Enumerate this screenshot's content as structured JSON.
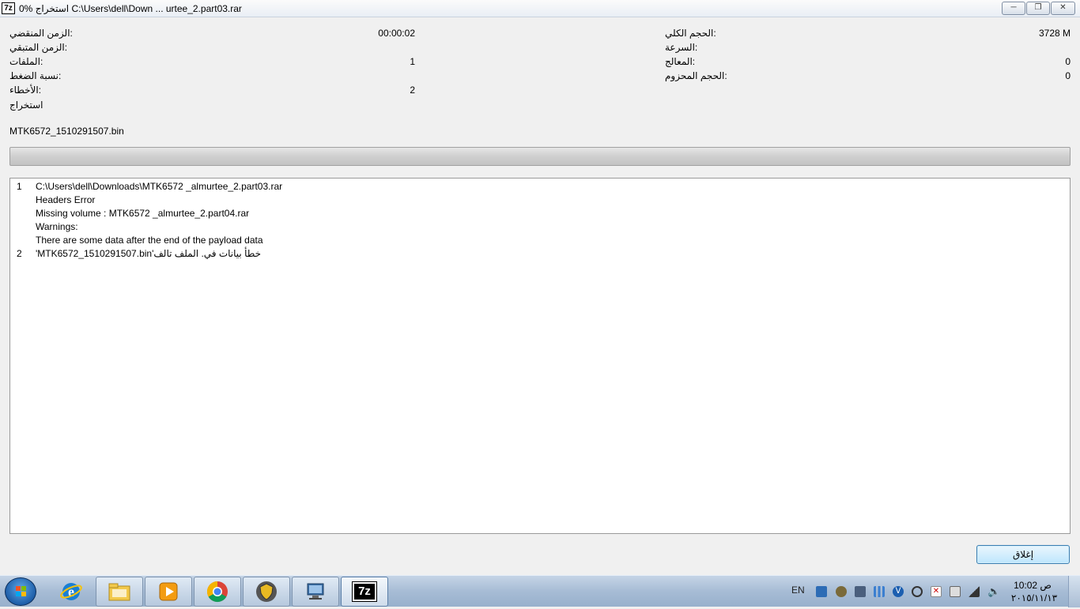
{
  "window": {
    "title": "0% استخراج C:\\Users\\dell\\Down ... urtee_2.part03.rar",
    "app_icon": "7z",
    "controls": {
      "minimize": "minimize-icon",
      "maximize": "restore-icon",
      "close": "close-icon"
    }
  },
  "stats_left": [
    {
      "label": "الزمن المنقضي:",
      "value": "00:00:02"
    },
    {
      "label": "الزمن المتبقي:",
      "value": ""
    },
    {
      "label": "الملفات:",
      "value": "1"
    },
    {
      "label": "نسبة الضغط:",
      "value": ""
    },
    {
      "label": "الأخطاء:",
      "value": "2"
    },
    {
      "label": "استخراج",
      "value": ""
    }
  ],
  "stats_right": [
    {
      "label": "الحجم الكلي:",
      "value": "3728 M"
    },
    {
      "label": "السرعة:",
      "value": ""
    },
    {
      "label": "المعالج:",
      "value": "0"
    },
    {
      "label": "الحجم المحزوم:",
      "value": "0"
    }
  ],
  "current_file": "MTK6572_1510291507.bin",
  "progress": {
    "percent": 0
  },
  "log": [
    {
      "num": "1",
      "text": "C:\\Users\\dell\\Downloads\\MTK6572  _almurtee_2.part03.rar"
    },
    {
      "num": "",
      "text": "Headers Error"
    },
    {
      "num": "",
      "text": "Missing volume : MTK6572  _almurtee_2.part04.rar"
    },
    {
      "num": "",
      "text": "Warnings:"
    },
    {
      "num": "",
      "text": "There are some data after the end of the payload data"
    },
    {
      "num": "2",
      "text": "'MTK6572_1510291507.bin'خطأ بيانات في. الملف تالف"
    }
  ],
  "buttons": {
    "close": "إغلاق"
  },
  "taskbar": {
    "pinned": [
      "internet-explorer-icon",
      "explorer-folder-icon",
      "media-player-icon",
      "chrome-icon",
      "security-shield-icon",
      "network-app-icon",
      "7zip-icon"
    ],
    "language": "EN",
    "clock_time": "ص 10:02",
    "clock_date": "٢٠١٥/١١/١٣"
  },
  "colors": {
    "accent": "#3c7fb1",
    "progress_track": "#cfcfcf",
    "taskbar": "#a7bcd5"
  }
}
